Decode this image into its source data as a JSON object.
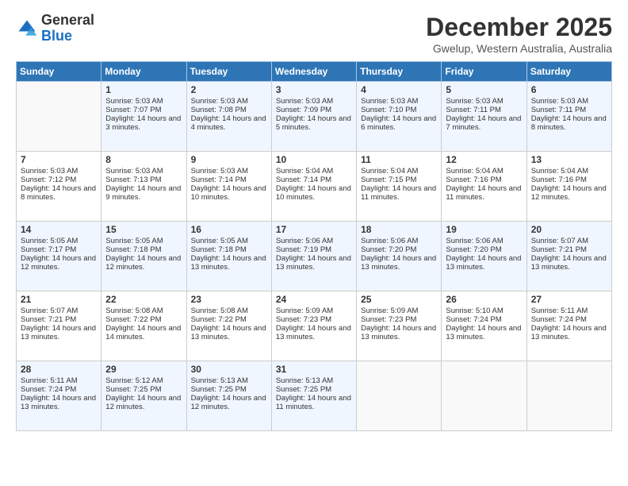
{
  "header": {
    "logo_general": "General",
    "logo_blue": "Blue",
    "month_title": "December 2025",
    "location": "Gwelup, Western Australia, Australia"
  },
  "calendar": {
    "days_of_week": [
      "Sunday",
      "Monday",
      "Tuesday",
      "Wednesday",
      "Thursday",
      "Friday",
      "Saturday"
    ],
    "weeks": [
      [
        {
          "day": "",
          "sunrise": "",
          "sunset": "",
          "daylight": ""
        },
        {
          "day": "1",
          "sunrise": "Sunrise: 5:03 AM",
          "sunset": "Sunset: 7:07 PM",
          "daylight": "Daylight: 14 hours and 3 minutes."
        },
        {
          "day": "2",
          "sunrise": "Sunrise: 5:03 AM",
          "sunset": "Sunset: 7:08 PM",
          "daylight": "Daylight: 14 hours and 4 minutes."
        },
        {
          "day": "3",
          "sunrise": "Sunrise: 5:03 AM",
          "sunset": "Sunset: 7:09 PM",
          "daylight": "Daylight: 14 hours and 5 minutes."
        },
        {
          "day": "4",
          "sunrise": "Sunrise: 5:03 AM",
          "sunset": "Sunset: 7:10 PM",
          "daylight": "Daylight: 14 hours and 6 minutes."
        },
        {
          "day": "5",
          "sunrise": "Sunrise: 5:03 AM",
          "sunset": "Sunset: 7:11 PM",
          "daylight": "Daylight: 14 hours and 7 minutes."
        },
        {
          "day": "6",
          "sunrise": "Sunrise: 5:03 AM",
          "sunset": "Sunset: 7:11 PM",
          "daylight": "Daylight: 14 hours and 8 minutes."
        }
      ],
      [
        {
          "day": "7",
          "sunrise": "Sunrise: 5:03 AM",
          "sunset": "Sunset: 7:12 PM",
          "daylight": "Daylight: 14 hours and 8 minutes."
        },
        {
          "day": "8",
          "sunrise": "Sunrise: 5:03 AM",
          "sunset": "Sunset: 7:13 PM",
          "daylight": "Daylight: 14 hours and 9 minutes."
        },
        {
          "day": "9",
          "sunrise": "Sunrise: 5:03 AM",
          "sunset": "Sunset: 7:14 PM",
          "daylight": "Daylight: 14 hours and 10 minutes."
        },
        {
          "day": "10",
          "sunrise": "Sunrise: 5:04 AM",
          "sunset": "Sunset: 7:14 PM",
          "daylight": "Daylight: 14 hours and 10 minutes."
        },
        {
          "day": "11",
          "sunrise": "Sunrise: 5:04 AM",
          "sunset": "Sunset: 7:15 PM",
          "daylight": "Daylight: 14 hours and 11 minutes."
        },
        {
          "day": "12",
          "sunrise": "Sunrise: 5:04 AM",
          "sunset": "Sunset: 7:16 PM",
          "daylight": "Daylight: 14 hours and 11 minutes."
        },
        {
          "day": "13",
          "sunrise": "Sunrise: 5:04 AM",
          "sunset": "Sunset: 7:16 PM",
          "daylight": "Daylight: 14 hours and 12 minutes."
        }
      ],
      [
        {
          "day": "14",
          "sunrise": "Sunrise: 5:05 AM",
          "sunset": "Sunset: 7:17 PM",
          "daylight": "Daylight: 14 hours and 12 minutes."
        },
        {
          "day": "15",
          "sunrise": "Sunrise: 5:05 AM",
          "sunset": "Sunset: 7:18 PM",
          "daylight": "Daylight: 14 hours and 12 minutes."
        },
        {
          "day": "16",
          "sunrise": "Sunrise: 5:05 AM",
          "sunset": "Sunset: 7:18 PM",
          "daylight": "Daylight: 14 hours and 13 minutes."
        },
        {
          "day": "17",
          "sunrise": "Sunrise: 5:06 AM",
          "sunset": "Sunset: 7:19 PM",
          "daylight": "Daylight: 14 hours and 13 minutes."
        },
        {
          "day": "18",
          "sunrise": "Sunrise: 5:06 AM",
          "sunset": "Sunset: 7:20 PM",
          "daylight": "Daylight: 14 hours and 13 minutes."
        },
        {
          "day": "19",
          "sunrise": "Sunrise: 5:06 AM",
          "sunset": "Sunset: 7:20 PM",
          "daylight": "Daylight: 14 hours and 13 minutes."
        },
        {
          "day": "20",
          "sunrise": "Sunrise: 5:07 AM",
          "sunset": "Sunset: 7:21 PM",
          "daylight": "Daylight: 14 hours and 13 minutes."
        }
      ],
      [
        {
          "day": "21",
          "sunrise": "Sunrise: 5:07 AM",
          "sunset": "Sunset: 7:21 PM",
          "daylight": "Daylight: 14 hours and 13 minutes."
        },
        {
          "day": "22",
          "sunrise": "Sunrise: 5:08 AM",
          "sunset": "Sunset: 7:22 PM",
          "daylight": "Daylight: 14 hours and 14 minutes."
        },
        {
          "day": "23",
          "sunrise": "Sunrise: 5:08 AM",
          "sunset": "Sunset: 7:22 PM",
          "daylight": "Daylight: 14 hours and 13 minutes."
        },
        {
          "day": "24",
          "sunrise": "Sunrise: 5:09 AM",
          "sunset": "Sunset: 7:23 PM",
          "daylight": "Daylight: 14 hours and 13 minutes."
        },
        {
          "day": "25",
          "sunrise": "Sunrise: 5:09 AM",
          "sunset": "Sunset: 7:23 PM",
          "daylight": "Daylight: 14 hours and 13 minutes."
        },
        {
          "day": "26",
          "sunrise": "Sunrise: 5:10 AM",
          "sunset": "Sunset: 7:24 PM",
          "daylight": "Daylight: 14 hours and 13 minutes."
        },
        {
          "day": "27",
          "sunrise": "Sunrise: 5:11 AM",
          "sunset": "Sunset: 7:24 PM",
          "daylight": "Daylight: 14 hours and 13 minutes."
        }
      ],
      [
        {
          "day": "28",
          "sunrise": "Sunrise: 5:11 AM",
          "sunset": "Sunset: 7:24 PM",
          "daylight": "Daylight: 14 hours and 13 minutes."
        },
        {
          "day": "29",
          "sunrise": "Sunrise: 5:12 AM",
          "sunset": "Sunset: 7:25 PM",
          "daylight": "Daylight: 14 hours and 12 minutes."
        },
        {
          "day": "30",
          "sunrise": "Sunrise: 5:13 AM",
          "sunset": "Sunset: 7:25 PM",
          "daylight": "Daylight: 14 hours and 12 minutes."
        },
        {
          "day": "31",
          "sunrise": "Sunrise: 5:13 AM",
          "sunset": "Sunset: 7:25 PM",
          "daylight": "Daylight: 14 hours and 11 minutes."
        },
        {
          "day": "",
          "sunrise": "",
          "sunset": "",
          "daylight": ""
        },
        {
          "day": "",
          "sunrise": "",
          "sunset": "",
          "daylight": ""
        },
        {
          "day": "",
          "sunrise": "",
          "sunset": "",
          "daylight": ""
        }
      ]
    ]
  }
}
